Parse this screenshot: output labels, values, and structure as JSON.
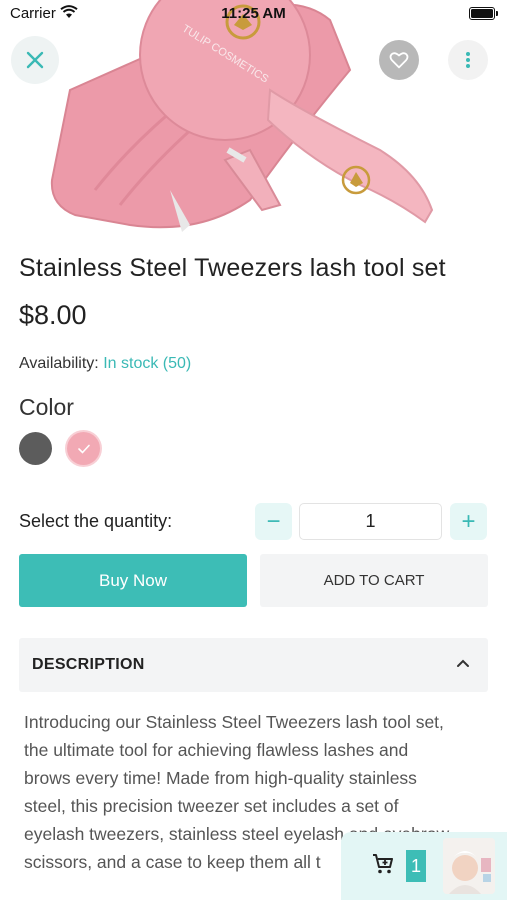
{
  "status_bar": {
    "carrier": "Carrier",
    "time": "11:25 AM"
  },
  "product": {
    "title": "Stainless Steel Tweezers lash tool set",
    "price": "$8.00",
    "availability_label": "Availability:",
    "availability_status": "In stock",
    "availability_count": "(50)",
    "brand_on_image": "TULIP COSMETICS"
  },
  "color": {
    "label": "Color",
    "options": [
      {
        "name": "gray",
        "hex": "#5c5c5c",
        "selected": false
      },
      {
        "name": "pink",
        "hex": "#f2a9b4",
        "selected": true
      }
    ]
  },
  "quantity": {
    "label": "Select the quantity:",
    "value": "1",
    "minus": "−",
    "plus": "+"
  },
  "actions": {
    "buy_now": "Buy Now",
    "add_to_cart": "ADD TO CART"
  },
  "description": {
    "header": "DESCRIPTION",
    "lines": [
      "Introducing our Stainless Steel Tweezers lash tool set,",
      "the ultimate tool for achieving flawless lashes and",
      "brows every time! Made from high-quality stainless",
      "steel, this precision tweezer set includes a set of",
      "eyelash tweezers, stainless steel eyelash and eyebrow",
      "scissors, and a case to keep them all t"
    ]
  },
  "floating_cart": {
    "count": "1"
  },
  "colors": {
    "accent": "#3dbdb6",
    "accent_light": "#e6f7f6",
    "neutral_button": "#f3f4f5"
  },
  "icons": [
    "close-icon",
    "heart-icon",
    "more-vertical-icon",
    "minus-icon",
    "plus-icon",
    "chevron-up-icon",
    "cart-icon",
    "check-icon",
    "wifi-icon",
    "battery-icon"
  ]
}
